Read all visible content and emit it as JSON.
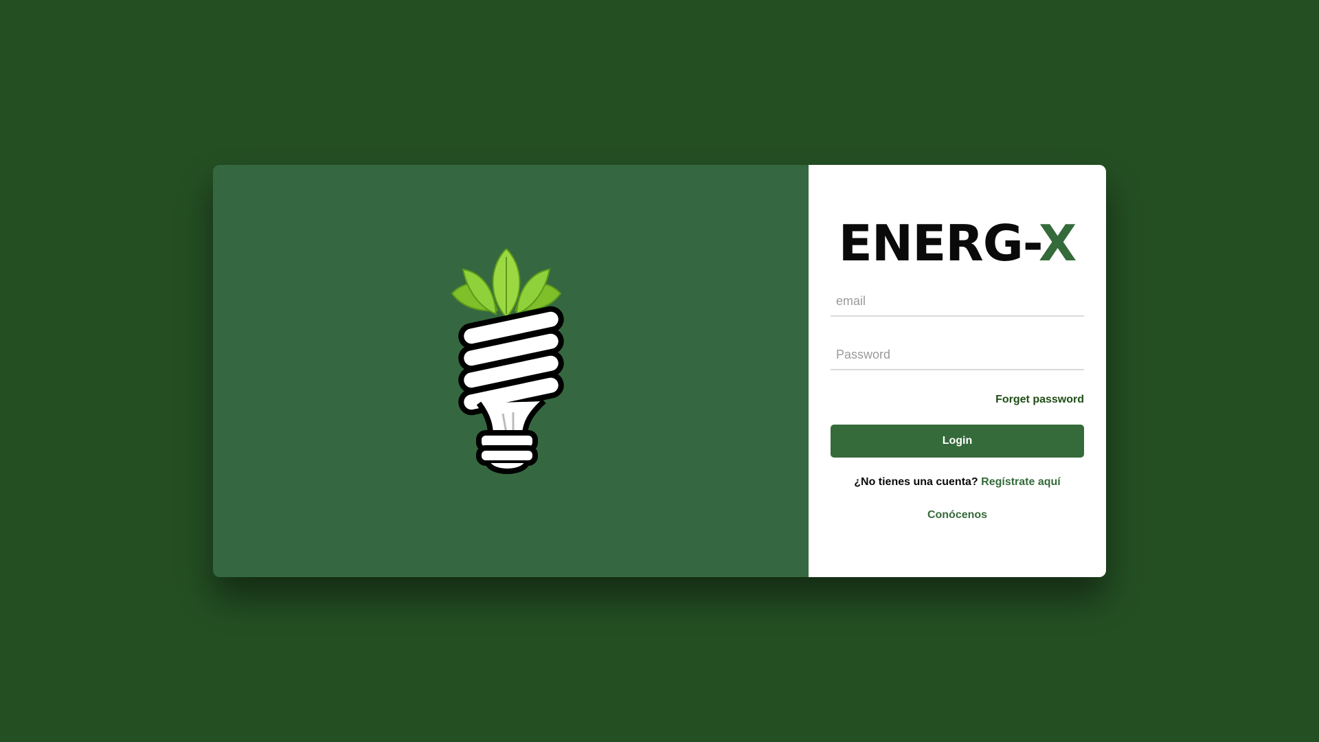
{
  "brand": {
    "title_main": "ENERG-",
    "title_accent": "X",
    "logo_icon": "eco-lightbulb-icon"
  },
  "form": {
    "email_placeholder": "email",
    "password_placeholder": "Password",
    "forget_password_label": "Forget password",
    "login_label": "Login",
    "register_prompt": "¿No tienes una cuenta?",
    "register_link": "Regístrate aquí",
    "about_link": "Conócenos"
  },
  "colors": {
    "page_background": "#244f23",
    "left_panel": "#356840",
    "accent": "#356a3a",
    "leaf_green": "#8cc63f"
  }
}
